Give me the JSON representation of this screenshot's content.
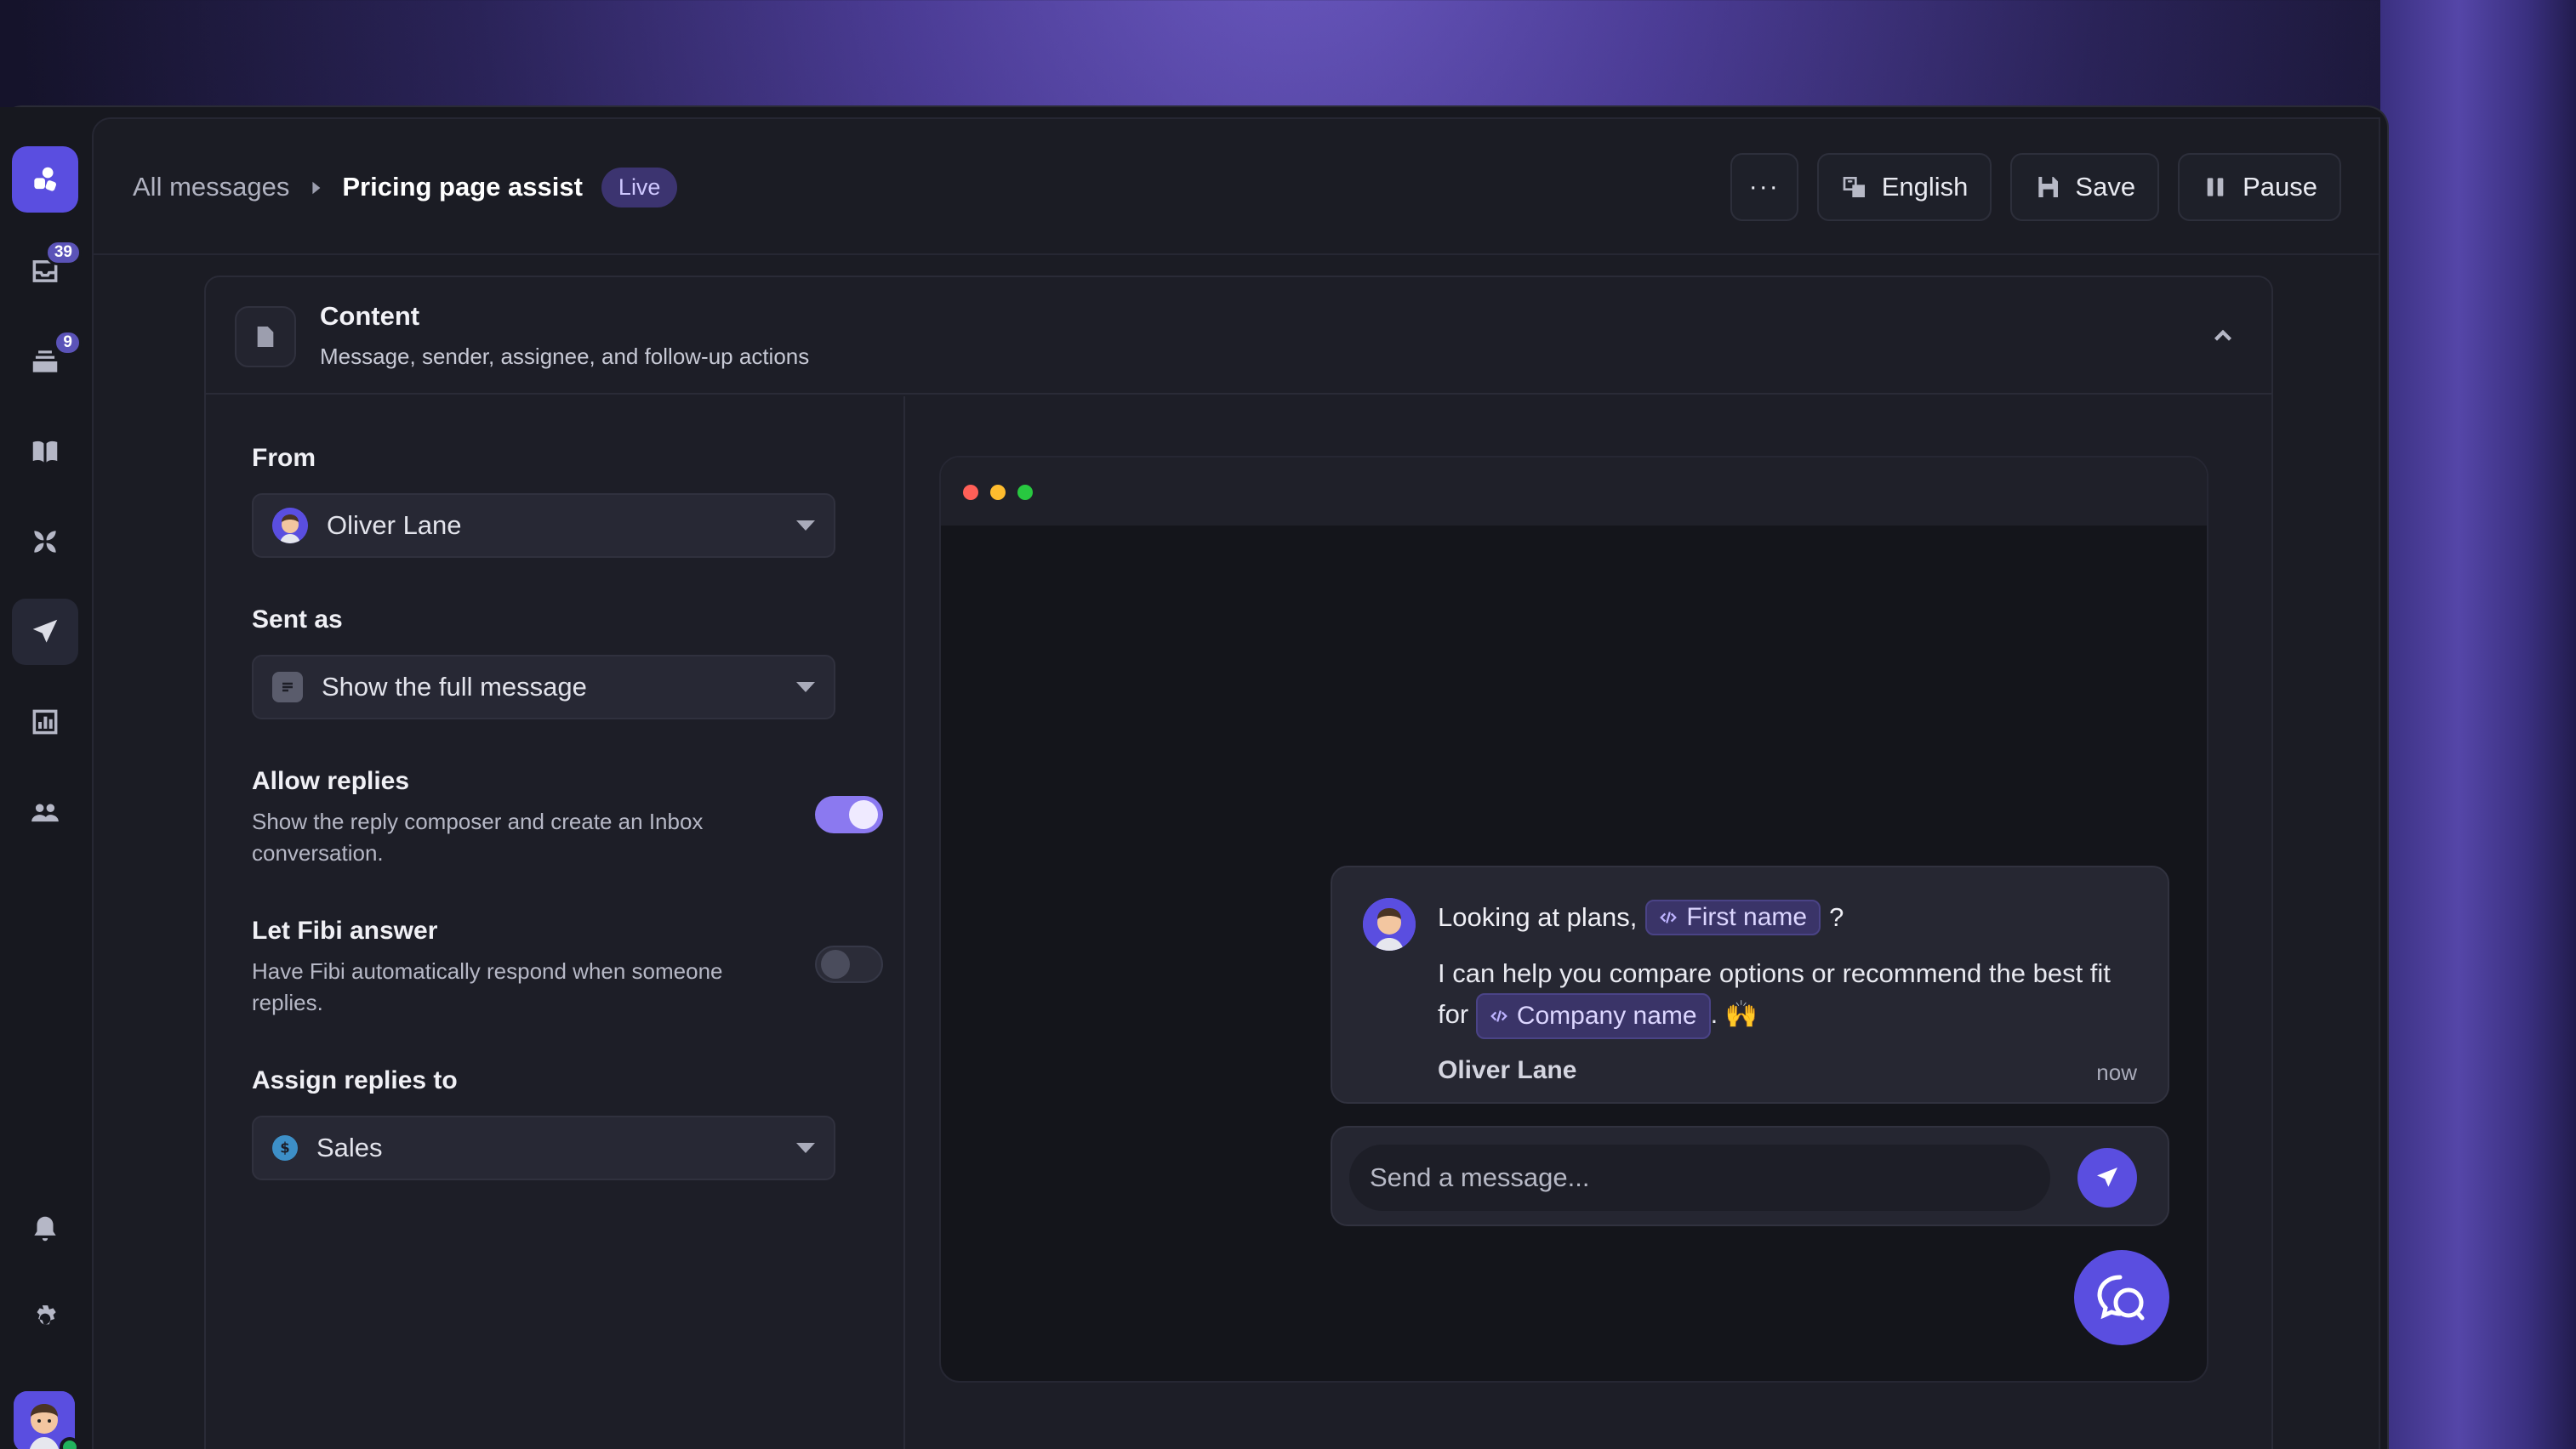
{
  "breadcrumb": {
    "parent": "All messages",
    "current": "Pricing page assist",
    "status": "Live"
  },
  "toolbar": {
    "more_label": "···",
    "language_label": "English",
    "save_label": "Save",
    "pause_label": "Pause"
  },
  "rail": {
    "inbox_badge": "39",
    "tickets_badge": "9",
    "items": [
      "logo-icon",
      "inbox-icon",
      "tickets-icon",
      "knowledge-icon",
      "apps-icon",
      "outbound-icon",
      "reports-icon",
      "contacts-icon",
      "notifications-icon",
      "settings-icon"
    ]
  },
  "section": {
    "title": "Content",
    "subtitle": "Message, sender, assignee, and follow-up actions"
  },
  "form": {
    "from_label": "From",
    "from_value": "Oliver Lane",
    "sent_as_label": "Sent as",
    "sent_as_value": "Show the full message",
    "allow_replies_label": "Allow replies",
    "allow_replies_desc": "Show the reply composer and create an Inbox conversation.",
    "allow_replies_on": true,
    "fibi_label": "Let Fibi answer",
    "fibi_desc": "Have Fibi automatically respond when someone replies.",
    "fibi_on": false,
    "assign_label": "Assign replies to",
    "assign_value": "Sales"
  },
  "preview": {
    "greeting_prefix": "Looking at plans,",
    "token_first_name": "First name",
    "greeting_suffix": "?",
    "body_prefix": "I can help you compare options or recommend the best fit for",
    "token_company": "Company name",
    "body_suffix": ". 🙌",
    "sender": "Oliver Lane",
    "time": "now",
    "composer_placeholder": "Send a message..."
  },
  "colors": {
    "accent": "#5a4ee0",
    "toggle_on": "#8b79f0",
    "live_pill": "#3c3470",
    "dot_red": "#ff5f57",
    "dot_yellow": "#febc2e",
    "dot_green": "#28c840"
  }
}
